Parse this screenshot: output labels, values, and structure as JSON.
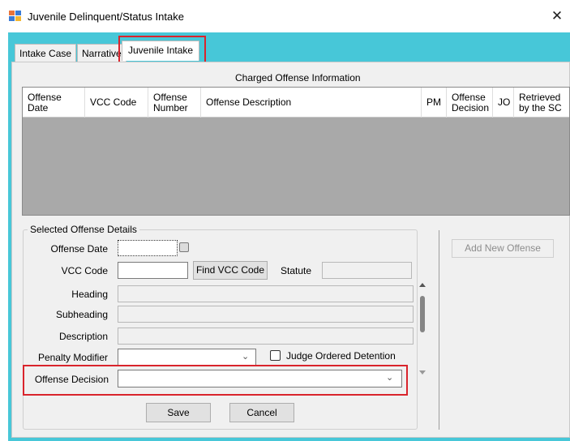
{
  "window": {
    "title": "Juvenile Delinquent/Status Intake",
    "close_glyph": "✕",
    "icon": "app-window-icon"
  },
  "tabs": [
    {
      "label": "Intake Case",
      "active": false
    },
    {
      "label": "Narrative",
      "active": false
    },
    {
      "label": "Juvenile Intake",
      "active": true
    }
  ],
  "charged_offense": {
    "section_title": "Charged Offense Information",
    "columns": [
      "Offense\nDate",
      "VCC Code",
      "Offense\nNumber",
      "Offense Description",
      "PM",
      "Offense\nDecision",
      "JO",
      "Retrieved\nby the SC"
    ],
    "rows": []
  },
  "selected_offense": {
    "group_title": "Selected Offense Details",
    "offense_date_label": "Offense Date",
    "offense_date_value": "",
    "vcc_code_label": "VCC Code",
    "vcc_code_value": "",
    "find_vcc_button": "Find VCC Code",
    "statute_label": "Statute",
    "statute_value": "",
    "heading_label": "Heading",
    "heading_value": "",
    "subheading_label": "Subheading",
    "subheading_value": "",
    "description_label": "Description",
    "description_value": "",
    "penalty_modifier_label": "Penalty Modifier",
    "penalty_modifier_value": "",
    "judge_ordered_detention_label": "Judge Ordered Detention",
    "judge_ordered_detention_checked": false,
    "offense_decision_label": "Offense Decision",
    "offense_decision_value": "",
    "save_button": "Save",
    "cancel_button": "Cancel"
  },
  "add_new_offense_button": "Add New Offense",
  "colors": {
    "accent": "#47c7d8",
    "highlight": "#d9242c",
    "grid_empty": "#a9a9a9"
  }
}
